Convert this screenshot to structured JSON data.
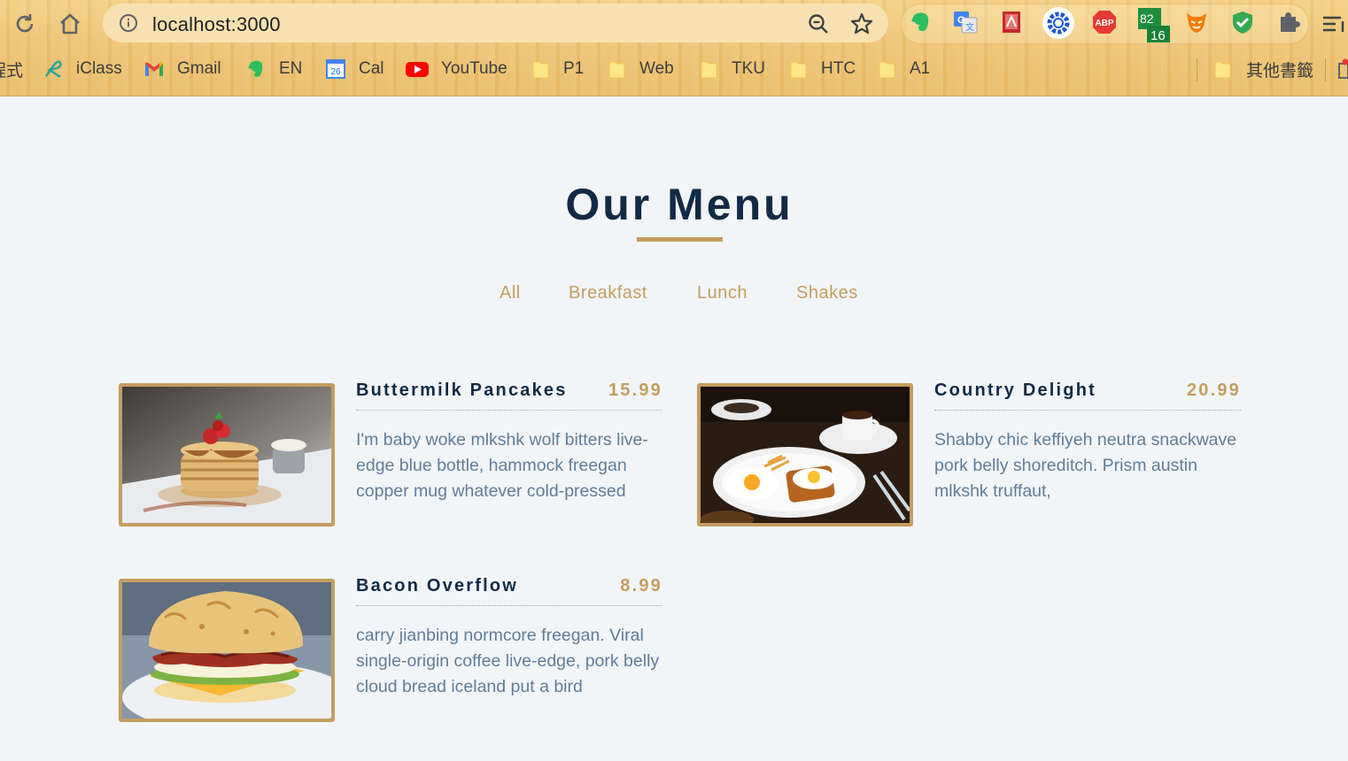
{
  "browser": {
    "url": "localhost:3000",
    "bookmarks": [
      {
        "label": "程式",
        "icon": "folder-icon"
      },
      {
        "label": "iClass",
        "icon": "iclass-icon"
      },
      {
        "label": "Gmail",
        "icon": "gmail-icon"
      },
      {
        "label": "EN",
        "icon": "evernote-icon"
      },
      {
        "label": "Cal",
        "icon": "calendar-icon"
      },
      {
        "label": "YouTube",
        "icon": "youtube-icon"
      },
      {
        "label": "P1",
        "icon": "folder-icon"
      },
      {
        "label": "Web",
        "icon": "folder-icon"
      },
      {
        "label": "TKU",
        "icon": "folder-icon"
      },
      {
        "label": "HTC",
        "icon": "folder-icon"
      },
      {
        "label": "A1",
        "icon": "folder-icon"
      }
    ],
    "other_bookmarks": "其他書籤",
    "calendar_day": "26",
    "extensions": {
      "adblock_label": "ABP",
      "counter_top": "82",
      "counter_badge": "16"
    }
  },
  "page": {
    "title": "Our Menu",
    "filters": [
      "All",
      "Breakfast",
      "Lunch",
      "Shakes"
    ],
    "items": [
      {
        "name": "Buttermilk Pancakes",
        "price": "15.99",
        "desc": "I'm baby woke mlkshk wolf bitters live-edge blue bottle, hammock freegan copper mug whatever cold-pressed",
        "image": "pancakes-photo"
      },
      {
        "name": "Country Delight",
        "price": "20.99",
        "desc": "Shabby chic keffiyeh neutra snackwave pork belly shoreditch. Prism austin mlkshk truffaut,",
        "image": "eggs-toast-photo"
      },
      {
        "name": "Bacon Overflow",
        "price": "8.99",
        "desc": "carry jianbing normcore freegan. Viral single-origin coffee live-edge, pork belly cloud bread iceland put a bird",
        "image": "bacon-sandwich-photo"
      }
    ]
  },
  "colors": {
    "accent": "#c59d5f",
    "heading": "#122a45",
    "text": "#617d98",
    "background": "#f1f5f8"
  }
}
